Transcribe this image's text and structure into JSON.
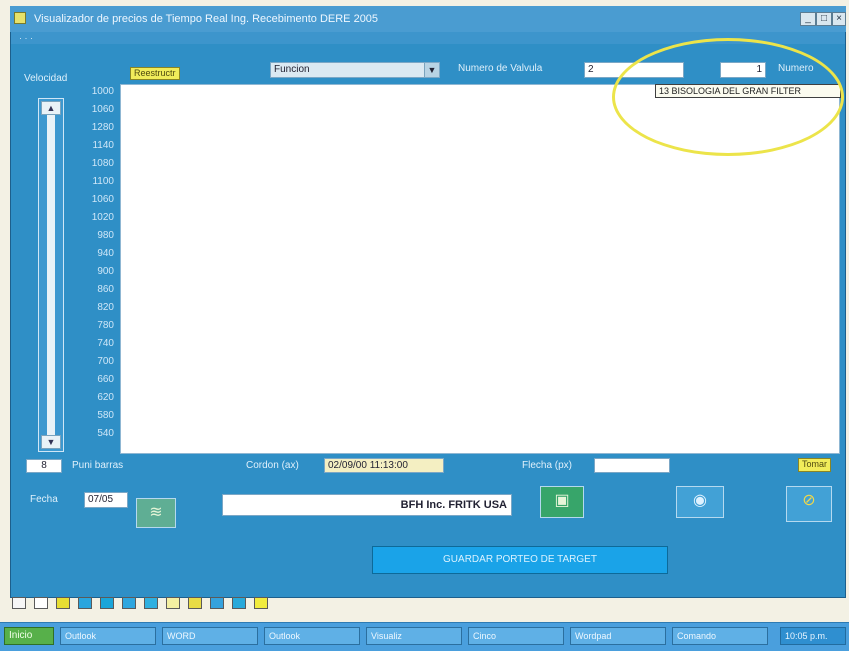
{
  "window": {
    "title": "Visualizador de precios de Tiempo Real Ing. Recebimento DERE 2005"
  },
  "toolbar": {
    "refresh_label": "Reestructr",
    "funcion_value": "Funcion",
    "numero_label": "Numero de Valvula",
    "numero_value": "2",
    "small_value": "1",
    "right_label": "Numero"
  },
  "tooltip": {
    "text": "13 BISOLOGIA DEL GRAN FILTER"
  },
  "plot": {
    "y_axis_label": "Velocidad",
    "y_ticks": [
      "1000",
      "1060",
      "1280",
      "1140",
      "1080",
      "1100",
      "1060",
      "1020",
      "980",
      "940",
      "900",
      "860",
      "820",
      "780",
      "740",
      "700",
      "660",
      "620",
      "580",
      "540"
    ]
  },
  "status": {
    "count_value": "8",
    "count_label": "Puni barras",
    "cordon_label": "Cordon (ax)",
    "cordon_value": "02/09/00 11:13:00",
    "flecha_label": "Flecha (px)",
    "right_button": "Tomar"
  },
  "bottom": {
    "fecha_label": "Fecha",
    "fecha_value": "07/05",
    "company_text": "BFH Inc. FRITK USA",
    "main_button": "GUARDAR PORTEO DE TARGET"
  },
  "swatch_colors": [
    "#f6f6f6",
    "#ffffff",
    "#e7de33",
    "#2aa5de",
    "#1aa5d9",
    "#2ea6df",
    "#2fb0e0",
    "#f4f0a2",
    "#e8dc45",
    "#35a2dd",
    "#28a9da",
    "#f1ec3e"
  ],
  "taskbar": {
    "start_label": "Inicio",
    "items": [
      "Outlook",
      "WORD",
      "Outlook",
      "Visualiz",
      "Cinco",
      "Wordpad",
      "Comando"
    ],
    "tray_label": "10:05 p.m."
  }
}
